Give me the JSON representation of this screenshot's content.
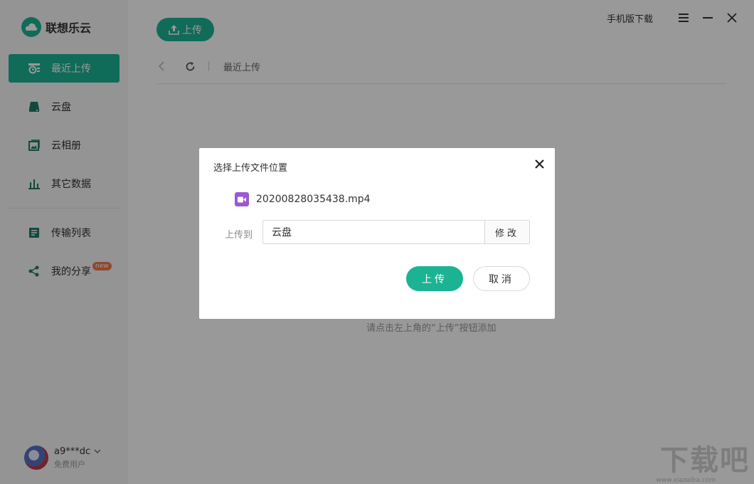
{
  "app": {
    "title": "联想乐云",
    "top_upload_label": "上传",
    "mobile_download": "手机版下载"
  },
  "sidebar": {
    "items": [
      {
        "label": "最近上传",
        "icon": "recent-upload-icon",
        "active": true
      },
      {
        "label": "云盘",
        "icon": "cloud-drive-icon"
      },
      {
        "label": "云相册",
        "icon": "photo-album-icon"
      },
      {
        "label": "其它数据",
        "icon": "bar-chart-icon"
      },
      {
        "label": "传输列表",
        "icon": "transfer-list-icon"
      },
      {
        "label": "我的分享",
        "icon": "share-icon",
        "badge": "new"
      }
    ]
  },
  "user": {
    "name": "a9***dc",
    "type": "免费用户"
  },
  "toolbar": {
    "breadcrumb": "最近上传"
  },
  "main": {
    "empty_hint": "请点击左上角的“上传”按钮添加"
  },
  "dialog": {
    "title": "选择上传文件位置",
    "file_name": "20200828035438.mp4",
    "dest_label": "上传到",
    "dest_value": "云盘",
    "modify_label": "修改",
    "upload_label": "上传",
    "cancel_label": "取消"
  },
  "watermark": {
    "text": "下载吧",
    "url": "www.xiazaiba.com"
  },
  "colors": {
    "accent": "#1cb394",
    "video_icon": "#9b59d0",
    "badge": "#f07a4a"
  }
}
